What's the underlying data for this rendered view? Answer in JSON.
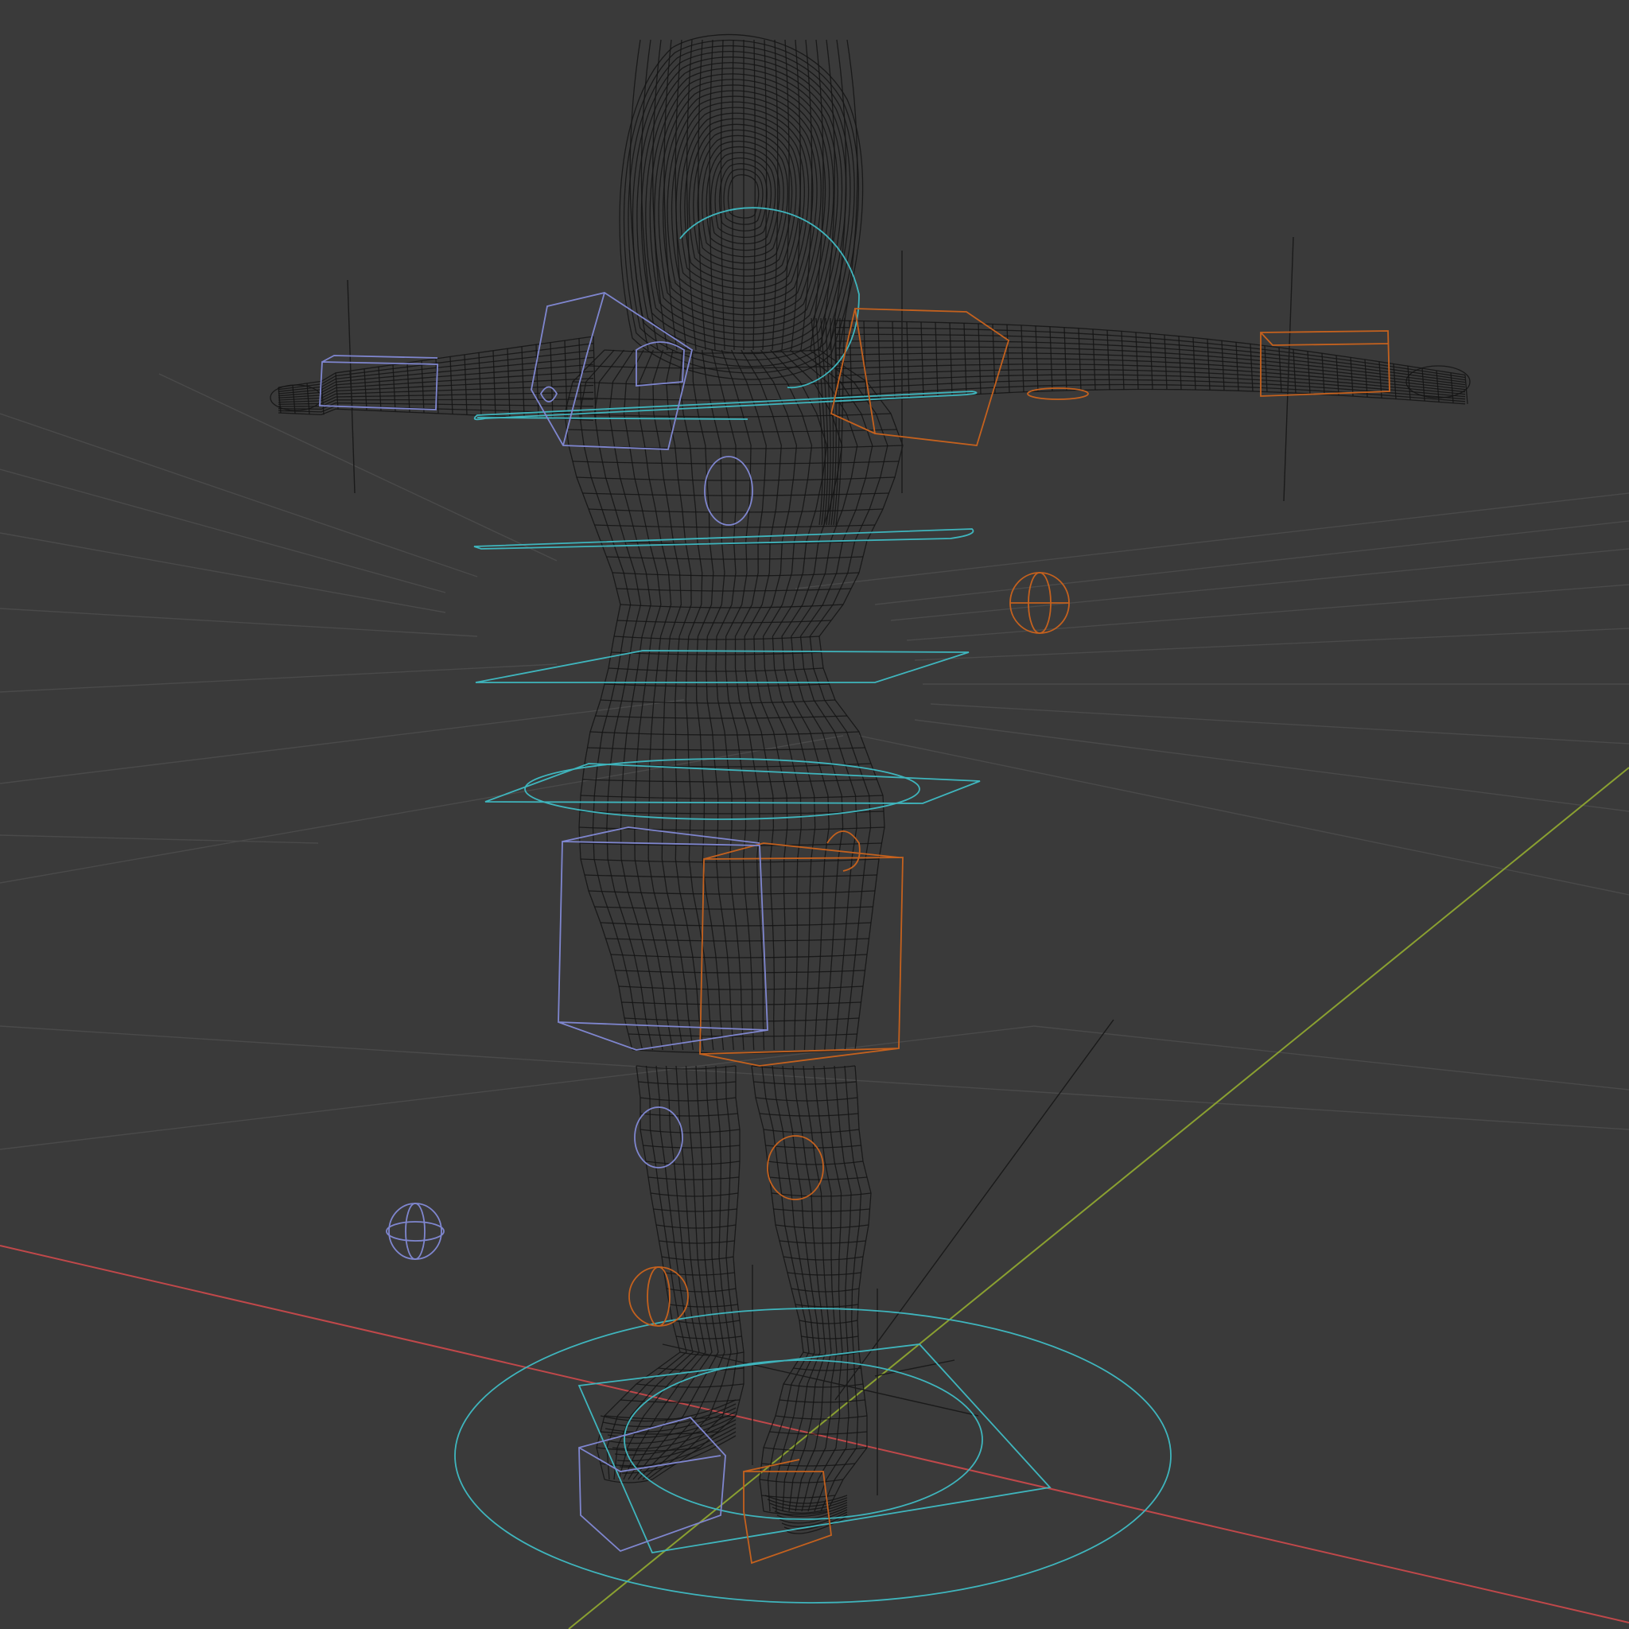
{
  "viewport": {
    "shading_mode": "wireframe",
    "object_type": "rigged character mesh",
    "pose": "T-pose"
  },
  "colors": {
    "background": "#3a3a3a",
    "grid": "#4a4a4a",
    "mesh_wire": "#141414",
    "x_axis": "#c0484a",
    "y_axis": "#8aa031",
    "controls_center": "#3fb5bd",
    "controls_left": "#c4611e",
    "controls_right": "#7f86cf"
  },
  "icons": {
    "x_axis": "x-axis-line",
    "y_axis": "y-axis-line",
    "root_control": "root-circle-control"
  }
}
